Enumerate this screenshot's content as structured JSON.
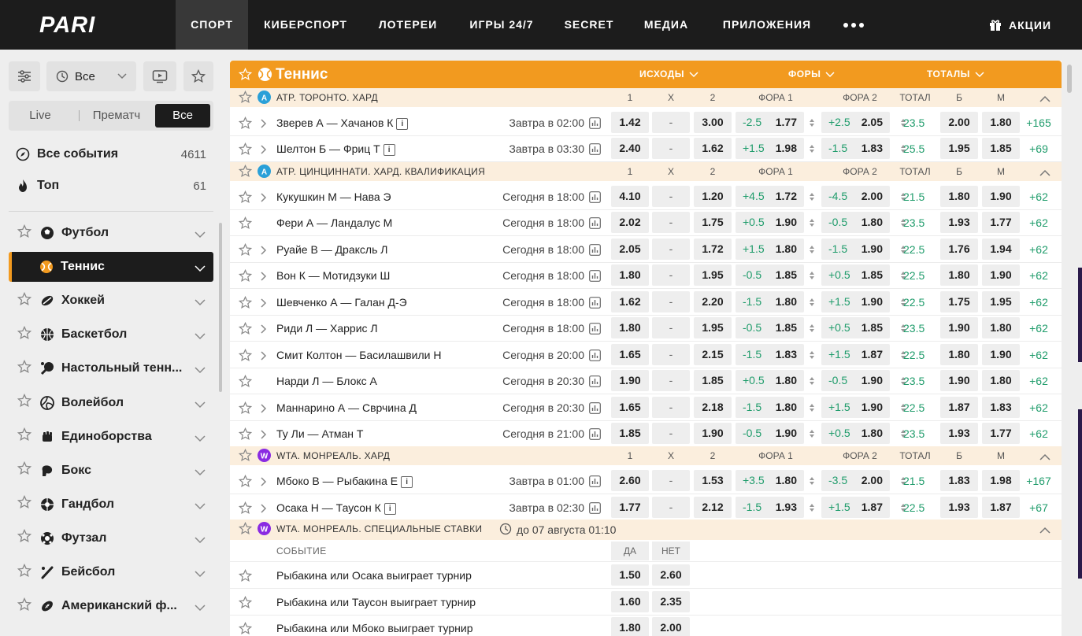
{
  "nav": {
    "logo": "PARI",
    "items": [
      {
        "label": "СПОРТ",
        "active": true
      },
      {
        "label": "КИБЕРСПОРТ"
      },
      {
        "label": "ЛОТЕРЕИ"
      },
      {
        "label": "ИГРЫ 24/7"
      },
      {
        "label": "SECRET"
      },
      {
        "label": "МЕДИА"
      },
      {
        "label": "ПРИЛОЖЕНИЯ"
      }
    ],
    "promo": "АКЦИИ"
  },
  "sidebar": {
    "period_select": "Все",
    "segments": [
      "Live",
      "Прематч",
      "Все"
    ],
    "all_events": {
      "label": "Все события",
      "count": "4611"
    },
    "top": {
      "label": "Топ",
      "count": "61"
    },
    "sports": [
      {
        "label": "Футбол",
        "icon": "soccer-ball-icon"
      },
      {
        "label": "Теннис",
        "icon": "tennis-ball-icon",
        "active": true
      },
      {
        "label": "Хоккей",
        "icon": "hockey-icon"
      },
      {
        "label": "Баскетбол",
        "icon": "basketball-icon"
      },
      {
        "label": "Настольный тенн...",
        "icon": "table-tennis-icon"
      },
      {
        "label": "Волейбол",
        "icon": "volleyball-icon"
      },
      {
        "label": "Единоборства",
        "icon": "fist-icon"
      },
      {
        "label": "Бокс",
        "icon": "boxing-glove-icon"
      },
      {
        "label": "Гандбол",
        "icon": "handball-icon"
      },
      {
        "label": "Футзал",
        "icon": "futsal-ball-icon"
      },
      {
        "label": "Бейсбол",
        "icon": "baseball-bat-icon"
      },
      {
        "label": "Американский ф...",
        "icon": "american-football-icon"
      }
    ]
  },
  "main": {
    "title": "Теннис",
    "col_groups": [
      "ИСХОДЫ",
      "ФОРЫ",
      "ТОТАЛЫ"
    ],
    "col_headers": [
      "1",
      "X",
      "2",
      "ФОРА 1",
      "ФОРА 2",
      "ТОТАЛ",
      "Б",
      "М"
    ],
    "leagues": [
      {
        "name": "ATP. ТОРОНТО. ХАРД",
        "events": [
          {
            "name": "Зверев А — Хачанов К",
            "info": true,
            "time": "Завтра в 02:00",
            "o1": "1.42",
            "x": "-",
            "o2": "3.00",
            "h1": "-2.5",
            "h1o": "1.77",
            "h2": "+2.5",
            "h2o": "2.05",
            "tot": "23.5",
            "b": "2.00",
            "m": "1.80",
            "more": "+165"
          },
          {
            "name": "Шелтон Б — Фриц Т",
            "info": true,
            "time": "Завтра в 03:30",
            "o1": "2.40",
            "x": "-",
            "o2": "1.62",
            "h1": "+1.5",
            "h1o": "1.98",
            "h2": "-1.5",
            "h2o": "1.83",
            "tot": "25.5",
            "b": "1.95",
            "m": "1.85",
            "more": "+69"
          }
        ]
      },
      {
        "name": "ATP. ЦИНЦИННАТИ. ХАРД. КВАЛИФИКАЦИЯ",
        "events": [
          {
            "name": "Кукушкин М — Нава Э",
            "time": "Сегодня в 18:00",
            "o1": "4.10",
            "x": "-",
            "o2": "1.20",
            "h1": "+4.5",
            "h1o": "1.72",
            "h2": "-4.5",
            "h2o": "2.00",
            "tot": "21.5",
            "b": "1.80",
            "m": "1.90",
            "more": "+62"
          },
          {
            "name": "Фери А — Ландалус М",
            "nochev": true,
            "time": "Сегодня в 18:00",
            "o1": "2.02",
            "x": "-",
            "o2": "1.75",
            "h1": "+0.5",
            "h1o": "1.90",
            "h2": "-0.5",
            "h2o": "1.80",
            "tot": "23.5",
            "b": "1.93",
            "m": "1.77",
            "more": "+62"
          },
          {
            "name": "Руайе В — Драксль Л",
            "time": "Сегодня в 18:00",
            "o1": "2.05",
            "x": "-",
            "o2": "1.72",
            "h1": "+1.5",
            "h1o": "1.80",
            "h2": "-1.5",
            "h2o": "1.90",
            "tot": "22.5",
            "b": "1.76",
            "m": "1.94",
            "more": "+62"
          },
          {
            "name": "Вон К — Мотидзуки Ш",
            "time": "Сегодня в 18:00",
            "o1": "1.80",
            "x": "-",
            "o2": "1.95",
            "h1": "-0.5",
            "h1o": "1.85",
            "h2": "+0.5",
            "h2o": "1.85",
            "tot": "22.5",
            "b": "1.80",
            "m": "1.90",
            "more": "+62"
          },
          {
            "name": "Шевченко А — Галан Д-Э",
            "time": "Сегодня в 18:00",
            "o1": "1.62",
            "x": "-",
            "o2": "2.20",
            "h1": "-1.5",
            "h1o": "1.80",
            "h2": "+1.5",
            "h2o": "1.90",
            "tot": "22.5",
            "b": "1.75",
            "m": "1.95",
            "more": "+62"
          },
          {
            "name": "Риди Л — Харрис Л",
            "time": "Сегодня в 18:00",
            "o1": "1.80",
            "x": "-",
            "o2": "1.95",
            "h1": "-0.5",
            "h1o": "1.85",
            "h2": "+0.5",
            "h2o": "1.85",
            "tot": "23.5",
            "b": "1.90",
            "m": "1.80",
            "more": "+62"
          },
          {
            "name": "Смит Колтон — Басилашвили Н",
            "time": "Сегодня в 20:00",
            "o1": "1.65",
            "x": "-",
            "o2": "2.15",
            "h1": "-1.5",
            "h1o": "1.83",
            "h2": "+1.5",
            "h2o": "1.87",
            "tot": "22.5",
            "b": "1.80",
            "m": "1.90",
            "more": "+62"
          },
          {
            "name": "Нарди Л — Блокс А",
            "nochev": true,
            "time": "Сегодня в 20:30",
            "o1": "1.90",
            "x": "-",
            "o2": "1.85",
            "h1": "+0.5",
            "h1o": "1.80",
            "h2": "-0.5",
            "h2o": "1.90",
            "tot": "23.5",
            "b": "1.90",
            "m": "1.80",
            "more": "+62"
          },
          {
            "name": "Маннарино А — Сврчина Д",
            "time": "Сегодня в 20:30",
            "o1": "1.65",
            "x": "-",
            "o2": "2.18",
            "h1": "-1.5",
            "h1o": "1.80",
            "h2": "+1.5",
            "h2o": "1.90",
            "tot": "22.5",
            "b": "1.87",
            "m": "1.83",
            "more": "+62"
          },
          {
            "name": "Ту Ли — Атман Т",
            "time": "Сегодня в 21:00",
            "o1": "1.85",
            "x": "-",
            "o2": "1.90",
            "h1": "-0.5",
            "h1o": "1.90",
            "h2": "+0.5",
            "h2o": "1.80",
            "tot": "23.5",
            "b": "1.93",
            "m": "1.77",
            "more": "+62"
          }
        ]
      },
      {
        "name": "WTA. МОНРЕАЛЬ. ХАРД",
        "events": [
          {
            "name": "Мбоко В — Рыбакина Е",
            "info": true,
            "time": "Завтра в 01:00",
            "o1": "2.60",
            "x": "-",
            "o2": "1.53",
            "h1": "+3.5",
            "h1o": "1.80",
            "h2": "-3.5",
            "h2o": "2.00",
            "tot": "21.5",
            "b": "1.83",
            "m": "1.98",
            "more": "+167"
          },
          {
            "name": "Осака Н — Таусон К",
            "info": true,
            "time": "Завтра в 02:30",
            "o1": "1.77",
            "x": "-",
            "o2": "2.12",
            "h1": "-1.5",
            "h1o": "1.93",
            "h2": "+1.5",
            "h2o": "1.87",
            "tot": "22.5",
            "b": "1.93",
            "m": "1.87",
            "more": "+67"
          }
        ]
      }
    ],
    "special": {
      "name": "WTA. МОНРЕАЛЬ. СПЕЦИАЛЬНЫЕ СТАВКИ",
      "until": "до 07 августа 01:10",
      "col_event": "СОБЫТИЕ",
      "col_yes": "ДА",
      "col_no": "НЕТ",
      "rows": [
        {
          "name": "Рыбакина или Осака выиграет турнир",
          "yes": "1.50",
          "no": "2.60"
        },
        {
          "name": "Рыбакина или Таусон выиграет турнир",
          "yes": "1.60",
          "no": "2.35"
        },
        {
          "name": "Рыбакина или Мбоко выиграет турнир",
          "yes": "1.80",
          "no": "2.00"
        }
      ]
    }
  },
  "colors": {
    "accent": "#f29a1f",
    "positive": "#1f9c6b",
    "dark": "#1c1c1c",
    "atp_icon": "#2aa0d8",
    "wta_icon": "#8a2be2"
  }
}
